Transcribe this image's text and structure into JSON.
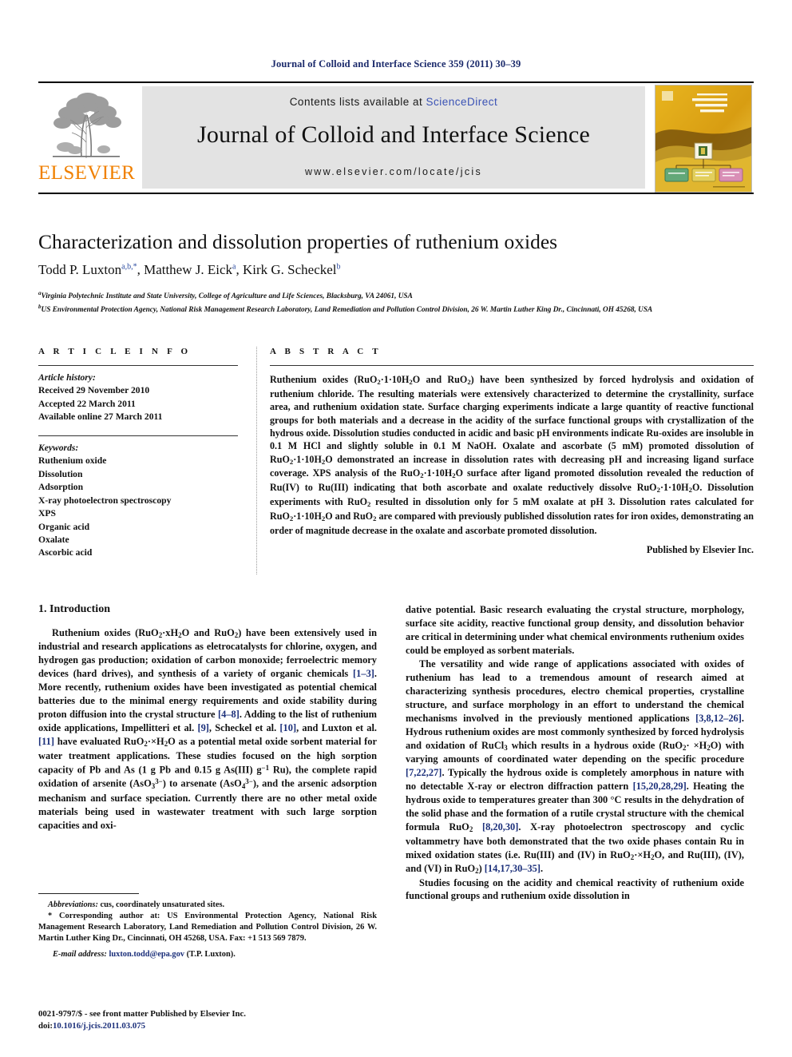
{
  "running_head": "Journal of Colloid and Interface Science 359 (2011) 30–39",
  "masthead": {
    "contents_prefix": "Contents lists available at ",
    "sciencedirect": "ScienceDirect",
    "journal_title": "Journal of Colloid and Interface Science",
    "journal_url": "www.elsevier.com/locate/jcis",
    "publisher_wordmark": "ELSEVIER",
    "cover_title_lines": [
      "JOURNAL OF",
      "COLLOID AND",
      "INTERFACE",
      "SCIENCE"
    ],
    "link_color": "#3b53b5",
    "wordmark_color": "#f08000",
    "banner_bg": "#e3e3e3"
  },
  "title": "Characterization and dissolution properties of ruthenium oxides",
  "authors": [
    {
      "name": "Todd P. Luxton",
      "marks": "a,b,*"
    },
    {
      "name": "Matthew J. Eick",
      "marks": "a"
    },
    {
      "name": "Kirk G. Scheckel",
      "marks": "b"
    }
  ],
  "affiliations": [
    {
      "mark": "a",
      "text": "Virginia Polytechnic Institute and State University, College of Agriculture and Life Sciences, Blacksburg, VA 24061, USA"
    },
    {
      "mark": "b",
      "text": "US Environmental Protection Agency, National Risk Management Research Laboratory, Land Remediation and Pollution Control Division, 26 W. Martin Luther King Dr., Cincinnati, OH 45268, USA"
    }
  ],
  "article_info": {
    "heading": "A R T I C L E   I N F O",
    "history_label": "Article history:",
    "history": [
      "Received 29 November 2010",
      "Accepted 22 March 2011",
      "Available online 27 March 2011"
    ],
    "keywords_label": "Keywords:",
    "keywords": [
      "Ruthenium oxide",
      "Dissolution",
      "Adsorption",
      "X-ray photoelectron spectroscopy",
      "XPS",
      "Organic acid",
      "Oxalate",
      "Ascorbic acid"
    ]
  },
  "abstract": {
    "heading": "A B S T R A C T",
    "publisher_line": "Published by Elsevier Inc."
  },
  "introduction": {
    "heading": "1. Introduction"
  },
  "footnotes": {
    "abbrev_label": "Abbreviations:",
    "abbrev_text": " cus, coordinately unsaturated sites.",
    "corresponding": "* Corresponding author at: US Environmental Protection Agency, National Risk Management Research Laboratory, Land Remediation and Pollution Control Division, 26 W. Martin Luther King Dr., Cincinnati, OH 45268, USA. Fax: +1 513 569 7879.",
    "email_label": "E-mail address:",
    "email": "luxton.todd@epa.gov",
    "email_suffix": " (T.P. Luxton).",
    "issn_line": "0021-9797/$ - see front matter Published by Elsevier Inc.",
    "doi_label": "doi:",
    "doi_value": "10.1016/j.jcis.2011.03.075"
  }
}
